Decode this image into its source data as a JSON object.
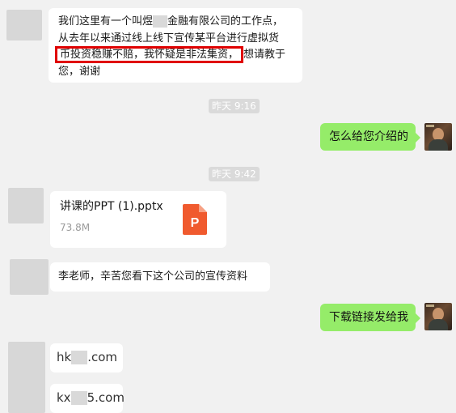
{
  "messages": {
    "m1": {
      "line1a": "我们这里有一个叫煜",
      "line1b": "金融有限公司的工作点，",
      "line2": "从去年以来通过线上线下宣传某平台进行虚拟货",
      "line3_highlight": "币投资稳赚不赔，我怀疑是非法集资，",
      "line3_rest": "想请教于",
      "line4": "您，谢谢"
    },
    "ts1": "昨天 9:16",
    "m2": "怎么给您介绍的",
    "ts2": "昨天 9:42",
    "file": {
      "name": "讲课的PPT (1).pptx",
      "size": "73.8M",
      "icon_letter": "P",
      "icon_color": "#f05a2e"
    },
    "m3": "李老师，辛苦您看下这个公司的宣传资料",
    "m4": "下载链接发给我",
    "link1": {
      "prefix": "hk",
      "suffix": ".com"
    },
    "link2": {
      "prefix": "kx",
      "suffix": "5.com"
    }
  },
  "colors": {
    "background": "#f1f1f1",
    "own_bubble": "#95ec69",
    "other_bubble": "#ffffff",
    "highlight_border": "#e00000"
  }
}
